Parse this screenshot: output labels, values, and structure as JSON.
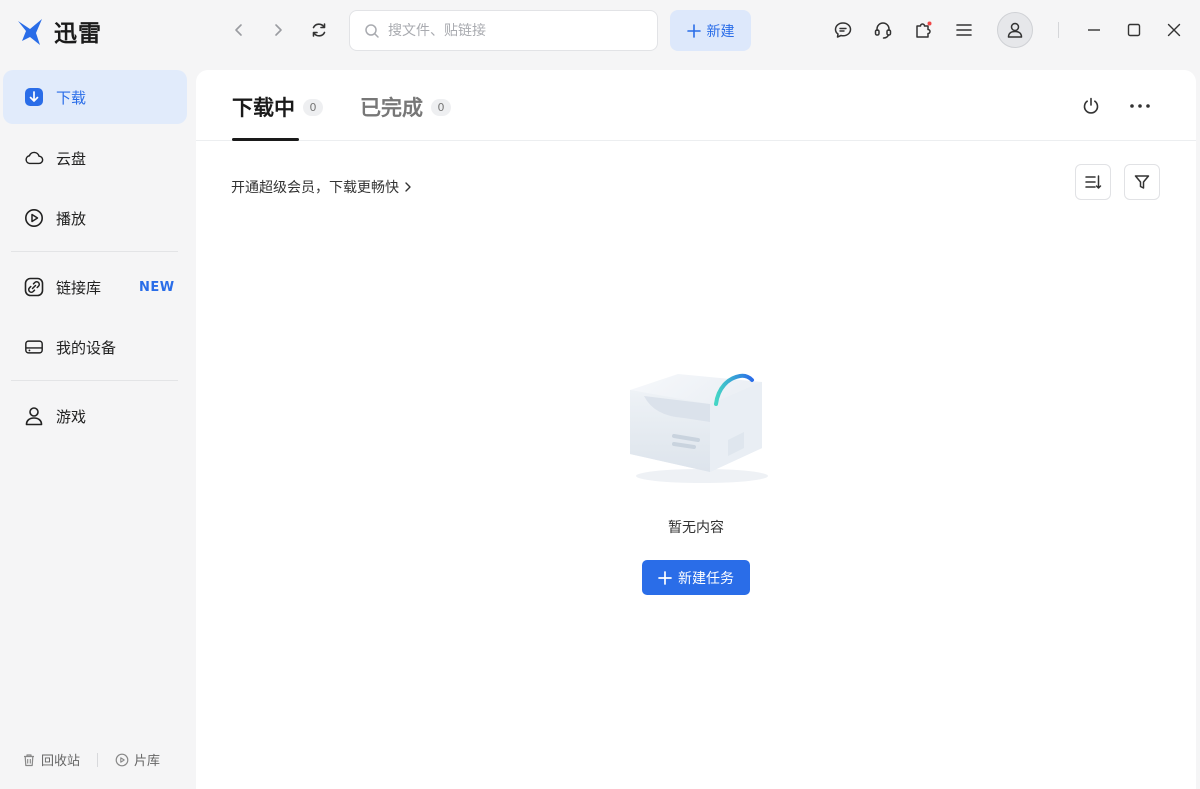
{
  "app": {
    "name": "迅雷",
    "accent": "#2a6de8"
  },
  "search": {
    "placeholder": "搜文件、贴链接",
    "icon": "search-icon"
  },
  "toolbar": {
    "new_label": "新建"
  },
  "sidebar": {
    "items": [
      {
        "label": "下载",
        "icon": "download-icon",
        "active": true
      },
      {
        "label": "云盘",
        "icon": "cloud-icon"
      },
      {
        "label": "播放",
        "icon": "play-icon"
      },
      {
        "label": "链接库",
        "icon": "link-icon",
        "badge": "NEW"
      },
      {
        "label": "我的设备",
        "icon": "device-icon"
      },
      {
        "label": "游戏",
        "icon": "game-icon"
      }
    ],
    "bottom": {
      "recycle": "回收站",
      "library": "片库"
    }
  },
  "tabs": [
    {
      "label": "下载中",
      "count": "0",
      "active": true
    },
    {
      "label": "已完成",
      "count": "0"
    }
  ],
  "promo": {
    "text": "开通超级会员，下载更畅快"
  },
  "empty": {
    "text": "暂无内容",
    "button": "新建任务"
  }
}
